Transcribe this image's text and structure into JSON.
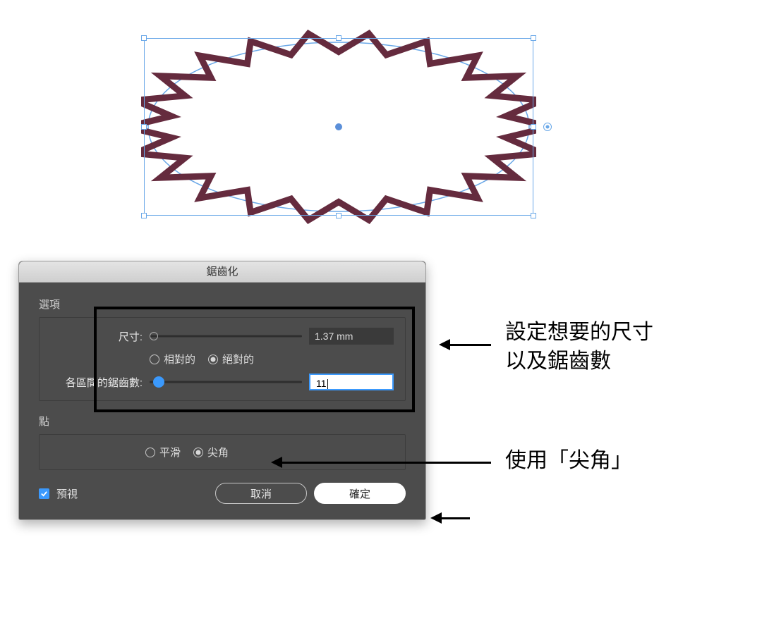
{
  "dialog": {
    "title": "鋸齒化",
    "section_options_label": "選項",
    "size": {
      "label": "尺寸:",
      "value": "1.37 mm",
      "slider_percent": 3
    },
    "size_mode": {
      "relative": "相對的",
      "absolute": "絕對的",
      "selected": "absolute"
    },
    "ridges": {
      "label": "各區間的鋸齒數:",
      "value": "11",
      "slider_percent": 6
    },
    "section_points_label": "點",
    "points": {
      "smooth": "平滑",
      "corner": "尖角",
      "selected": "corner"
    },
    "preview_label": "預視",
    "preview_checked": true,
    "cancel_label": "取消",
    "ok_label": "確定"
  },
  "annotations": {
    "upper_line1": "設定想要的尺寸",
    "upper_line2": "以及鋸齒數",
    "lower": "使用「尖角」"
  },
  "artwork": {
    "stroke": "#652b3e",
    "selection_color": "#6aa8e8"
  }
}
